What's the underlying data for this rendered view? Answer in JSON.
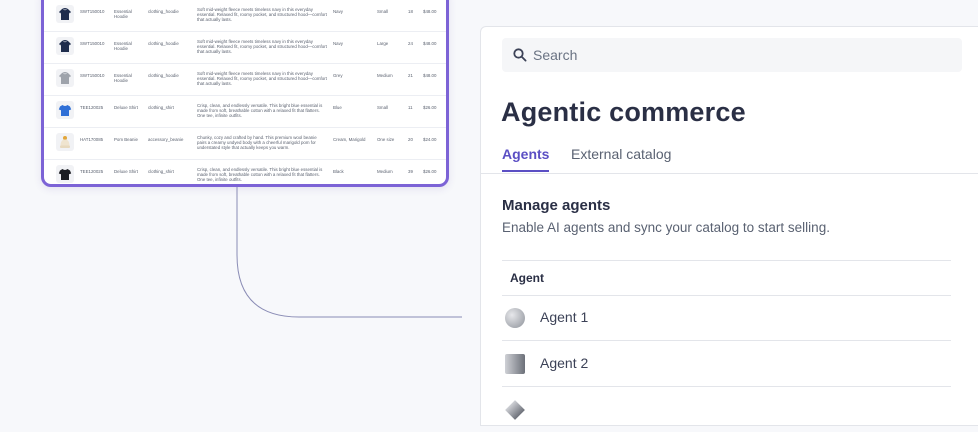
{
  "catalog": {
    "rows": [
      {
        "sku": "SWT150010",
        "title": "Essential Hoodie",
        "category": "clothing_hoodie",
        "description": "Soft mid-weight fleece meets timeless navy in this everyday essential. Relaxed fit, roomy pocket, and structured hood—comfort that actually lasts.",
        "color": "Navy",
        "size": "Small",
        "stock": "18",
        "price": "$48.00",
        "icon": "hoodie-navy-icon"
      },
      {
        "sku": "SWT150010",
        "title": "Essential Hoodie",
        "category": "clothing_hoodie",
        "description": "Soft mid-weight fleece meets timeless navy in this everyday essential. Relaxed fit, roomy pocket, and structured hood—comfort that actually lasts.",
        "color": "Navy",
        "size": "Large",
        "stock": "24",
        "price": "$48.00",
        "icon": "hoodie-navy-icon"
      },
      {
        "sku": "SWT150010",
        "title": "Essential Hoodie",
        "category": "clothing_hoodie",
        "description": "Soft mid-weight fleece meets timeless navy in this everyday essential. Relaxed fit, roomy pocket, and structured hood—comfort that actually lasts.",
        "color": "Grey",
        "size": "Medium",
        "stock": "21",
        "price": "$48.00",
        "icon": "hoodie-grey-icon"
      },
      {
        "sku": "TEE120025",
        "title": "Deluxe Shirt",
        "category": "clothing_shirt",
        "description": "Crisp, clean, and endlessly versatile. This bright blue essential is made from soft, breathable cotton with a relaxed fit that flatters. One tee, infinite outfits.",
        "color": "Blue",
        "size": "Small",
        "stock": "11",
        "price": "$26.00",
        "icon": "tshirt-blue-icon"
      },
      {
        "sku": "HAT170085",
        "title": "Pom Beanie",
        "category": "accessory_beanie",
        "description": "Chunky, cozy and crafted by hand. This premium wool beanie pairs a creamy undyed body with a cheerful marigold pom for understated style that actually keeps you warm.",
        "color": "Cream, Marigold",
        "size": "One size",
        "stock": "20",
        "price": "$24.00",
        "icon": "beanie-icon"
      },
      {
        "sku": "TEE120025",
        "title": "Deluxe Shirt",
        "category": "clothing_shirt",
        "description": "Crisp, clean, and endlessly versatile. This bright blue essential is made from soft, breathable cotton with a relaxed fit that flatters. One tee, infinite outfits.",
        "color": "Black",
        "size": "Medium",
        "stock": "39",
        "price": "$26.00",
        "icon": "tshirt-black-icon"
      }
    ]
  },
  "search": {
    "placeholder": "Search"
  },
  "page": {
    "title": "Agentic commerce"
  },
  "tabs": [
    {
      "label": "Agents",
      "active": true
    },
    {
      "label": "External catalog",
      "active": false
    }
  ],
  "section": {
    "title": "Manage agents",
    "subtitle": "Enable AI agents and sync your catalog to start selling."
  },
  "table": {
    "header": "Agent"
  },
  "agents": [
    {
      "name": "Agent 1",
      "icon": "gray-circle-icon"
    },
    {
      "name": "Agent 2",
      "icon": "gray-square-icon"
    },
    {
      "name": "",
      "icon": "gray-diamond-icon"
    }
  ],
  "colors": {
    "accent": "#5b4fc4",
    "card_border": "#7c63d6",
    "navy": "#1f2d4d",
    "blue": "#2f6fd6"
  }
}
